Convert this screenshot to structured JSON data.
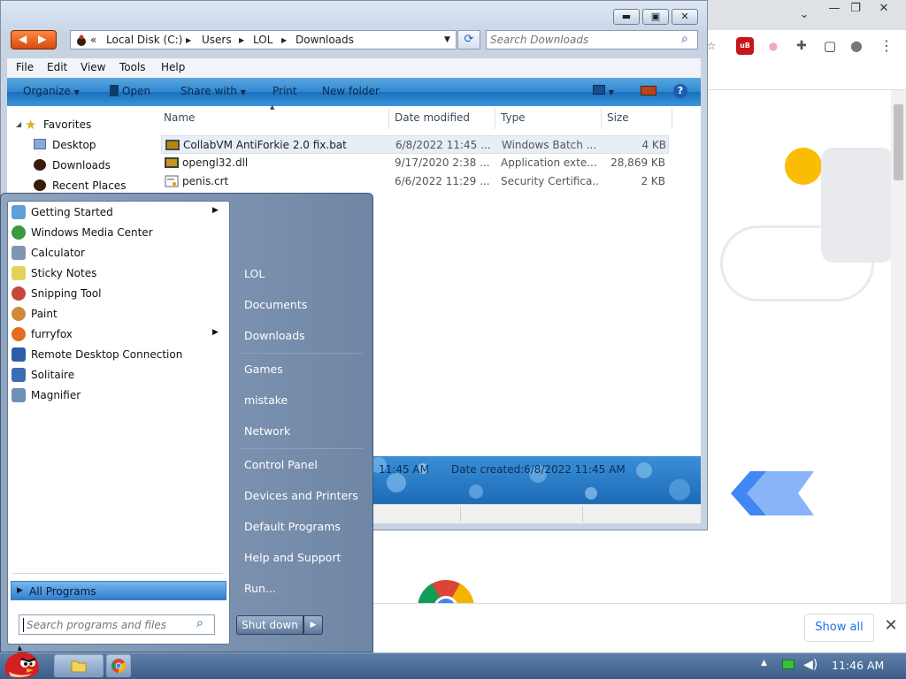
{
  "chrome": {
    "minimize_glyph": "—",
    "maximize_glyph": "❐",
    "close_glyph": "✕",
    "expand_glyph": "⌄",
    "show_all_label": "Show all",
    "download_close_glyph": "✕",
    "extensions": [
      {
        "icon": "star-icon",
        "glyph": "☆"
      },
      {
        "icon": "ublock-icon",
        "glyph": "uB",
        "color": "#c4161c"
      },
      {
        "icon": "flag-extension-icon",
        "glyph": "●"
      },
      {
        "icon": "puzzle-icon",
        "glyph": "✚"
      },
      {
        "icon": "side-panel-icon",
        "glyph": "▢"
      },
      {
        "icon": "profile-icon",
        "glyph": "●"
      },
      {
        "icon": "kebab-menu-icon",
        "glyph": "⋮"
      }
    ]
  },
  "explorer": {
    "window_controls": {
      "minimize": "▬",
      "maximize": "▣",
      "close": "✕"
    },
    "nav": {
      "back": "◀",
      "forward": "▶"
    },
    "address": {
      "overflow": "«",
      "parts": [
        "Local Disk (C:)",
        "Users",
        "LOL",
        "Downloads"
      ],
      "separator": "▶",
      "dropdown": "▼"
    },
    "refresh_glyph": "⟳",
    "search_placeholder": "Search Downloads",
    "search_icon_glyph": "⌕",
    "menu": [
      "File",
      "Edit",
      "View",
      "Tools",
      "Help"
    ],
    "commands": {
      "organize": "Organize",
      "open": "Open",
      "share_with": "Share with",
      "print": "Print",
      "new_folder": "New folder",
      "help_glyph": "?"
    },
    "navpane": {
      "favorites_label": "Favorites",
      "items": [
        "Desktop",
        "Downloads",
        "Recent Places"
      ]
    },
    "columns": {
      "name": "Name",
      "date_modified": "Date modified",
      "type": "Type",
      "size": "Size"
    },
    "files": [
      {
        "name": "CollabVM AntiForkie 2.0 fix.bat",
        "date": "6/8/2022 11:45 ...",
        "type": "Windows Batch ...",
        "size": "4 KB",
        "selected": true
      },
      {
        "name": "opengl32.dll",
        "date": "9/17/2020 2:38 ...",
        "type": "Application exte...",
        "size": "28,869 KB",
        "selected": false
      },
      {
        "name": "penis.crt",
        "date": "6/6/2022 11:29 ...",
        "type": "Security Certifica...",
        "size": "2 KB",
        "selected": false
      }
    ],
    "details": {
      "modified_fragment": "11:45 AM",
      "created_label": "Date created:",
      "created_value": "6/8/2022 11:45 AM"
    }
  },
  "startmenu": {
    "programs": [
      {
        "label": "Getting Started",
        "icon": "getting-started-icon",
        "color": "#5fa0d8",
        "submenu": true
      },
      {
        "label": "Windows Media Center",
        "icon": "media-center-icon",
        "color": "#3c9a3c",
        "submenu": false
      },
      {
        "label": "Calculator",
        "icon": "calculator-icon",
        "color": "#7f96b2",
        "submenu": false
      },
      {
        "label": "Sticky Notes",
        "icon": "sticky-notes-icon",
        "color": "#e3d35a",
        "submenu": false
      },
      {
        "label": "Snipping Tool",
        "icon": "snipping-tool-icon",
        "color": "#c8463a",
        "submenu": false
      },
      {
        "label": "Paint",
        "icon": "paint-icon",
        "color": "#d08a3a",
        "submenu": false
      },
      {
        "label": "furryfox",
        "icon": "furryfox-icon",
        "color": "#e66a1f",
        "submenu": true
      },
      {
        "label": "Remote Desktop Connection",
        "icon": "remote-desktop-icon",
        "color": "#2d5fa8",
        "submenu": false
      },
      {
        "label": "Solitaire",
        "icon": "solitaire-icon",
        "color": "#3b6cb4",
        "submenu": false
      },
      {
        "label": "Magnifier",
        "icon": "magnifier-icon",
        "color": "#6f8fb8",
        "submenu": false
      }
    ],
    "submenu_arrow": "▶",
    "all_programs_label": "All Programs",
    "all_programs_arrow": "▶",
    "search_placeholder": "Search programs and files",
    "search_icon_glyph": "⌕",
    "right": {
      "group1": [
        "LOL",
        "Documents",
        "Downloads"
      ],
      "group2": [
        "Games",
        "mistake",
        "Network"
      ],
      "group3": [
        "Control Panel",
        "Devices and Printers",
        "Default Programs",
        "Help and Support",
        "Run..."
      ]
    },
    "shutdown_label": "Shut down",
    "shutdown_arrow": "▶"
  },
  "taskbar": {
    "clock": "11:46 AM",
    "tray_expand": "▲"
  }
}
